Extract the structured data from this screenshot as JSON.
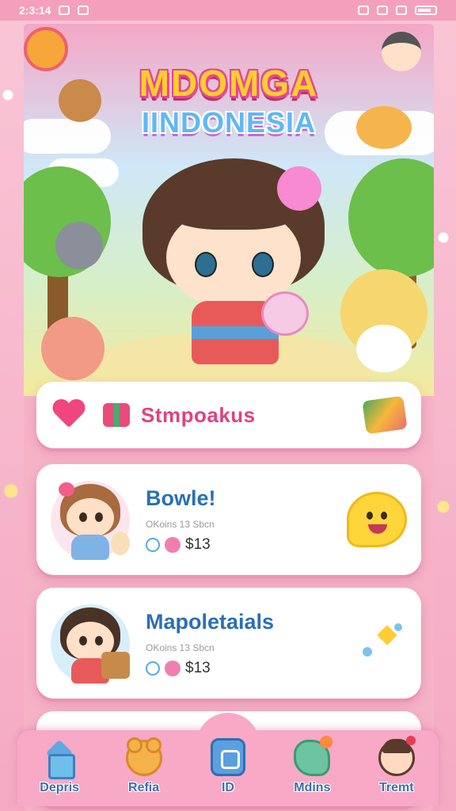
{
  "status_bar": {
    "time": "2:3:14"
  },
  "hero": {
    "title_line1": "MDOMGA",
    "title_line2": "IINDONESIA"
  },
  "banner": {
    "text": "Stmpoakus"
  },
  "items": [
    {
      "title": "Bowle!",
      "subtitle": "OKoins 13 Sbcn",
      "price": "$13"
    },
    {
      "title": "Mapoletaials",
      "subtitle": "OKoins 13 Sbcn",
      "price": "$13"
    }
  ],
  "nav": [
    {
      "label": "Depris",
      "icon": "house-icon"
    },
    {
      "label": "Refia",
      "icon": "bear-icon"
    },
    {
      "label": "ID",
      "icon": "center-app-icon"
    },
    {
      "label": "Mdins",
      "icon": "dino-icon"
    },
    {
      "label": "Tremt",
      "icon": "girl-avatar-icon"
    }
  ],
  "colors": {
    "accent_pink": "#e0427f",
    "title_blue": "#2b6fb3",
    "nav_label": "#3c6fa6",
    "background": "#f7b8cc"
  }
}
